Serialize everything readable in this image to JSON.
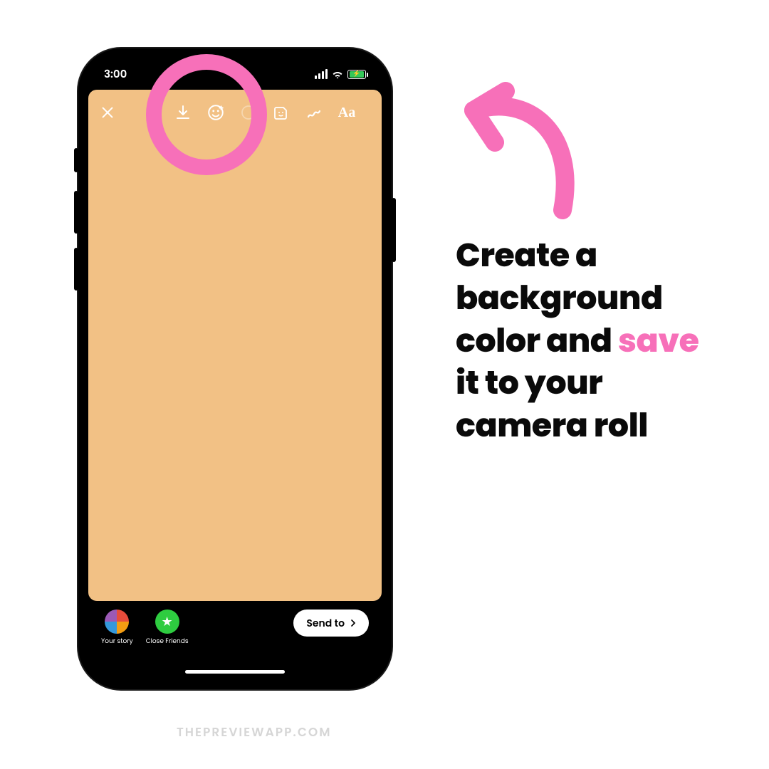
{
  "statusbar": {
    "time": "3:00"
  },
  "toolbar": {
    "text_label": "Aa"
  },
  "share": {
    "your_story": "Your story",
    "close_friends": "Close Friends",
    "send_to": "Send to"
  },
  "instruction": {
    "line1": "Create a background color and ",
    "accent": "save",
    "line2": " it to your camera roll"
  },
  "watermark": "THEPREVIEWAPP.COM",
  "colors": {
    "accent_pink": "#f770b9",
    "canvas_bg": "#f2c185"
  }
}
